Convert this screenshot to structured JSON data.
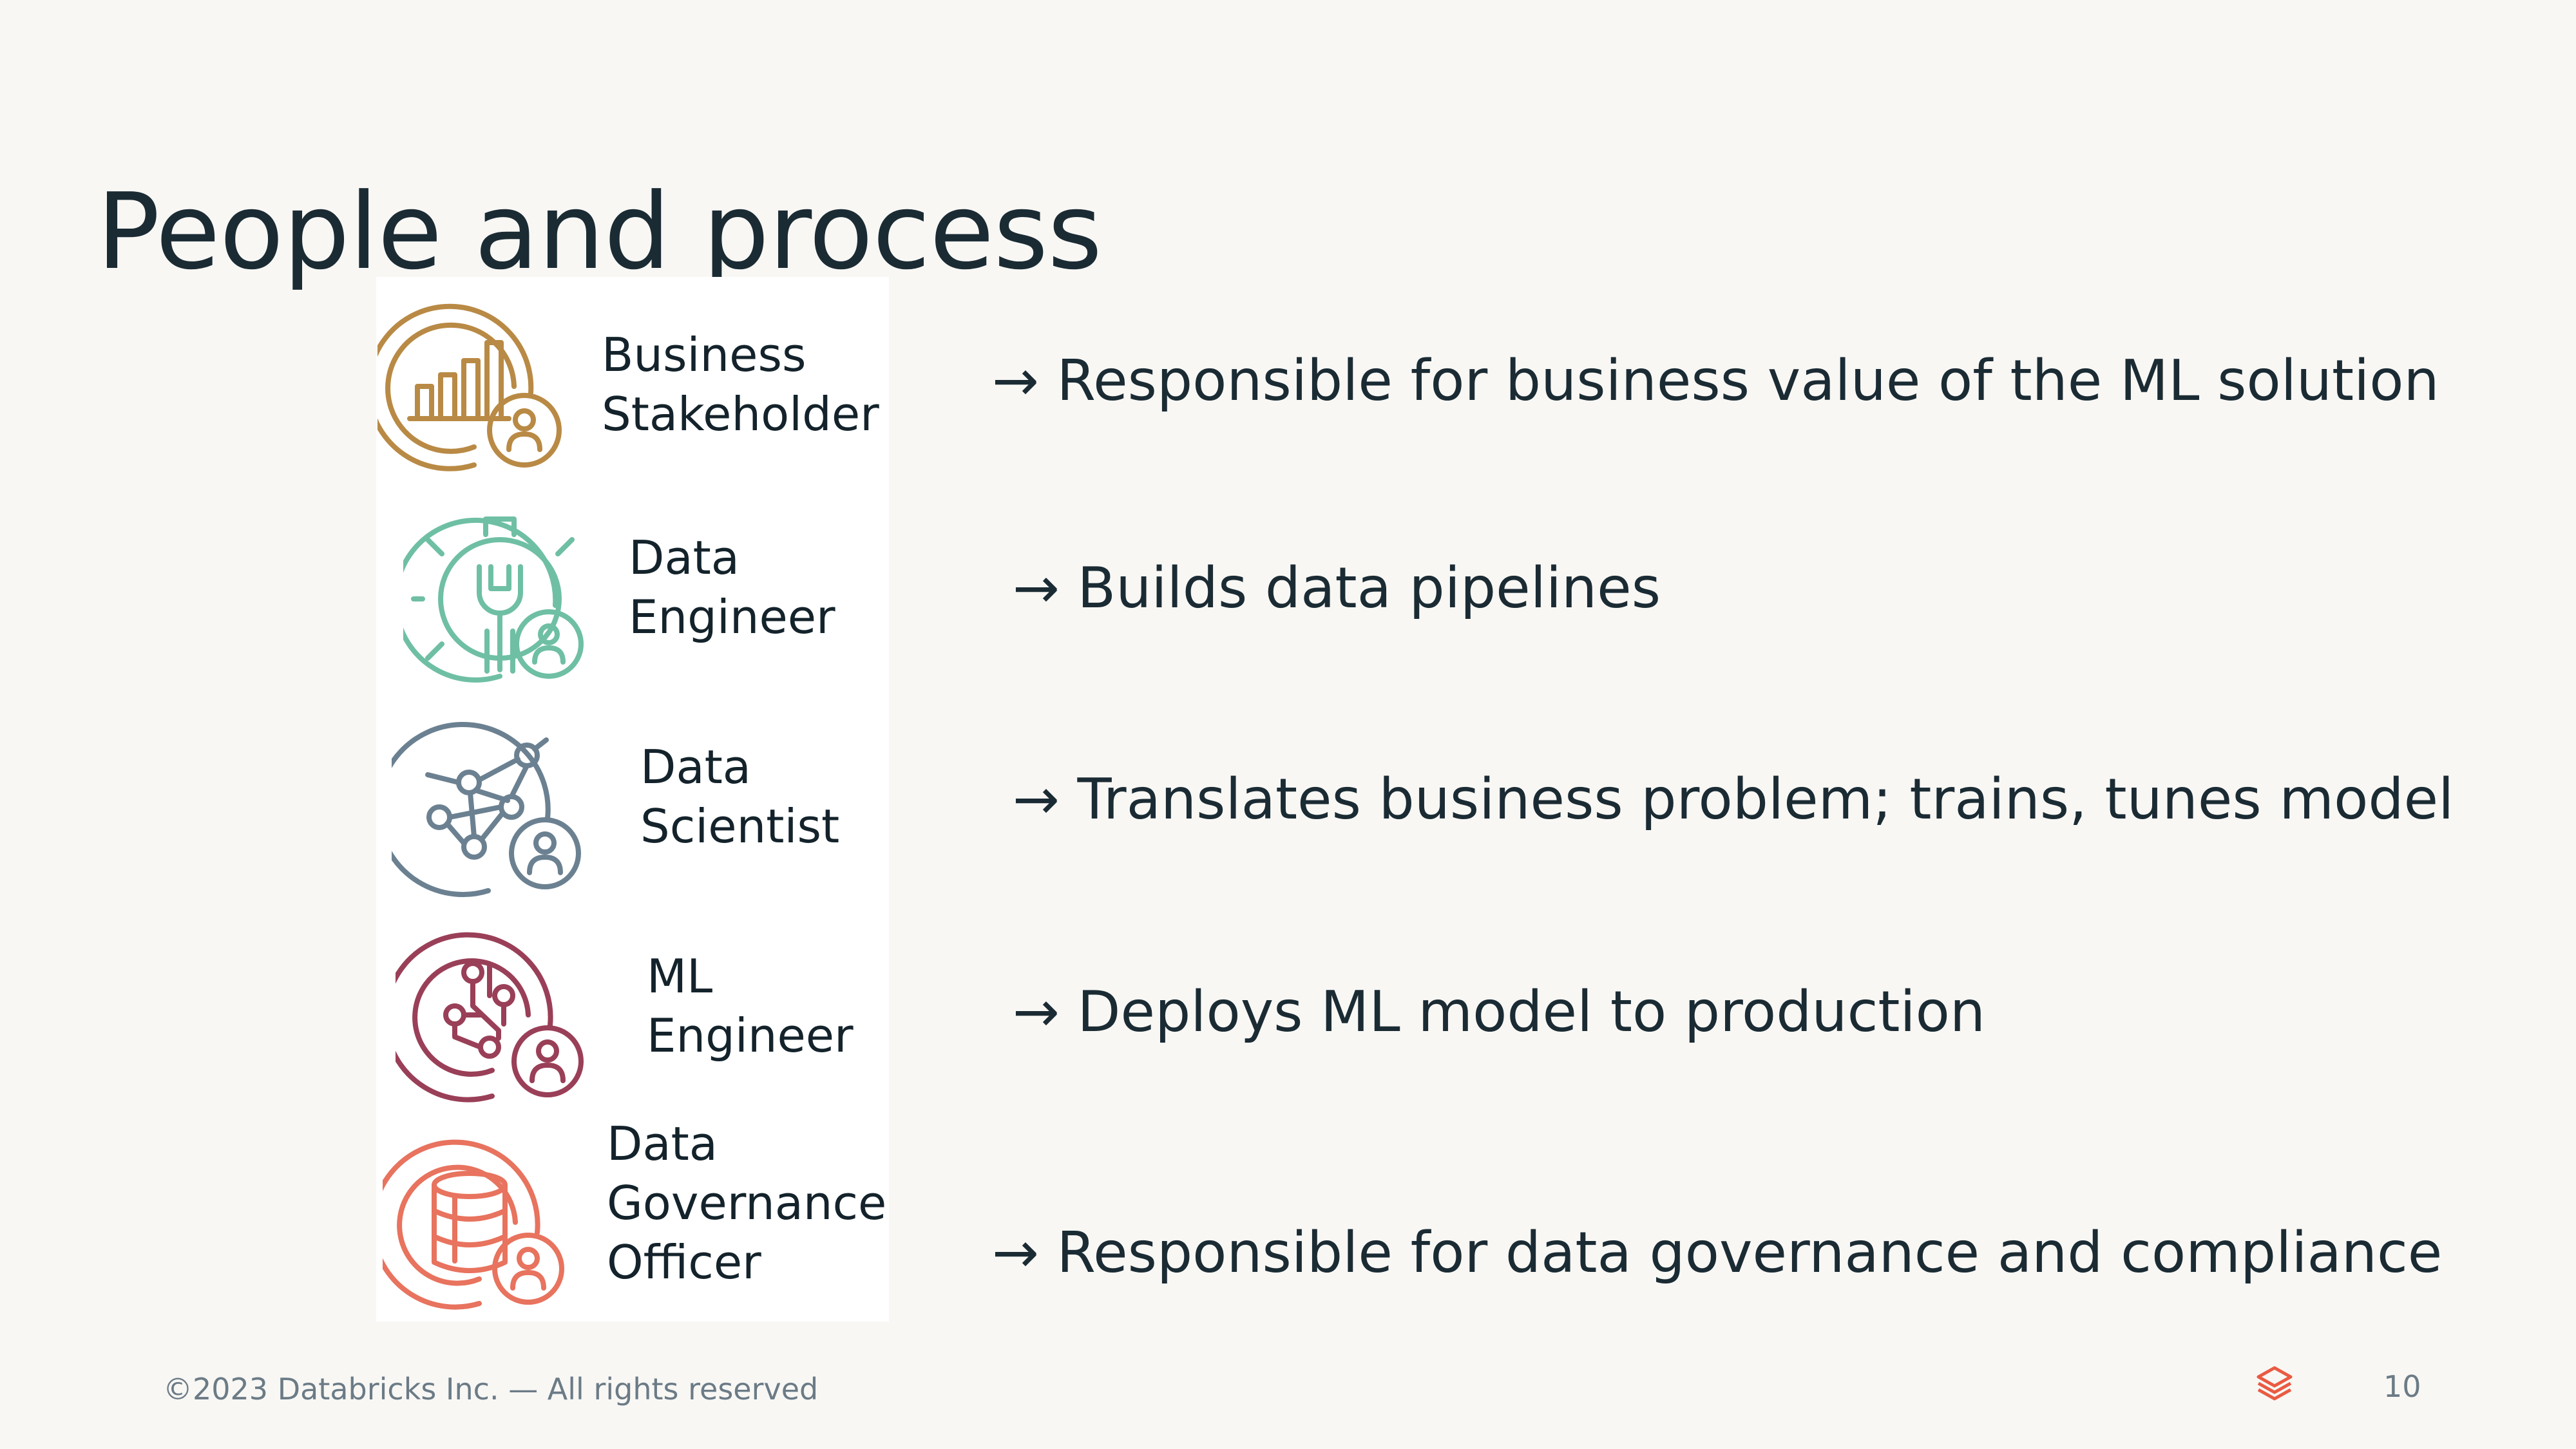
{
  "slide": {
    "title": "People and process",
    "roles": [
      {
        "label_lines": [
          "Business",
          "Stakeholder"
        ],
        "icon": "business-stakeholder-icon",
        "color": "#b98a45",
        "description": "→ Responsible for business value of the ML solution"
      },
      {
        "label_lines": [
          "Data",
          "Engineer"
        ],
        "icon": "data-engineer-icon",
        "color": "#6fbfa5",
        "description": "→ Builds data pipelines"
      },
      {
        "label_lines": [
          "Data",
          "Scientist"
        ],
        "icon": "data-scientist-icon",
        "color": "#6b8191",
        "description": "→ Translates business problem; trains, tunes model"
      },
      {
        "label_lines": [
          "ML",
          "Engineer"
        ],
        "icon": "ml-engineer-icon",
        "color": "#9a3f58",
        "description": "→ Deploys ML model to production"
      },
      {
        "label_lines": [
          "Data",
          "Governance",
          "Officer"
        ],
        "icon": "data-governance-officer-icon",
        "color": "#e8735e",
        "description": "→ Responsible for data governance and compliance"
      }
    ],
    "footer": "©2023 Databricks Inc. — All rights reserved",
    "page_number": "10",
    "logo_icon": "databricks-logo-icon",
    "logo_color": "#ea5a42"
  }
}
